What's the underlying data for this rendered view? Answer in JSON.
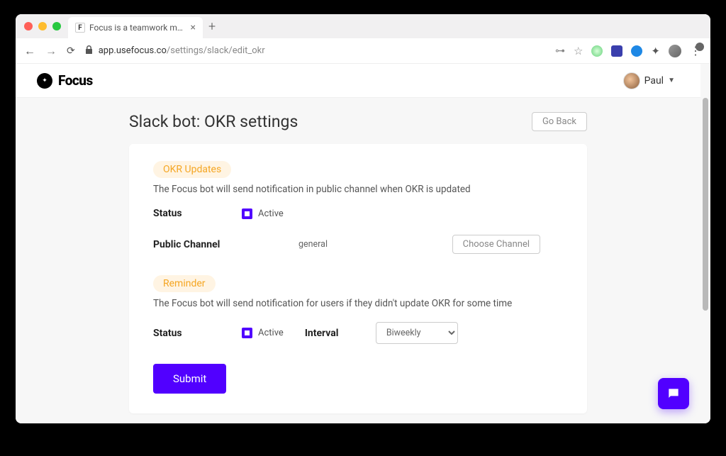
{
  "browser_tab": {
    "title": "Focus is a teamwork managem",
    "favicon_letter": "F"
  },
  "url": {
    "host": "app.usefocus.co",
    "path": "/settings/slack/edit_okr"
  },
  "app": {
    "logo_text": "Focus",
    "user_name": "Paul"
  },
  "page": {
    "title": "Slack bot: OKR settings",
    "go_back_label": "Go Back"
  },
  "sections": {
    "okr_updates": {
      "pill": "OKR Updates",
      "description": "The Focus bot will send notification in public channel when OKR is updated",
      "status_label": "Status",
      "status_value": "Active",
      "channel_label": "Public Channel",
      "channel_value": "general",
      "choose_channel_label": "Choose Channel"
    },
    "reminder": {
      "pill": "Reminder",
      "description": "The Focus bot will send notification for users if they didn't update OKR for some time",
      "status_label": "Status",
      "status_value": "Active",
      "interval_label": "Interval",
      "interval_value": "Biweekly"
    }
  },
  "submit_label": "Submit"
}
